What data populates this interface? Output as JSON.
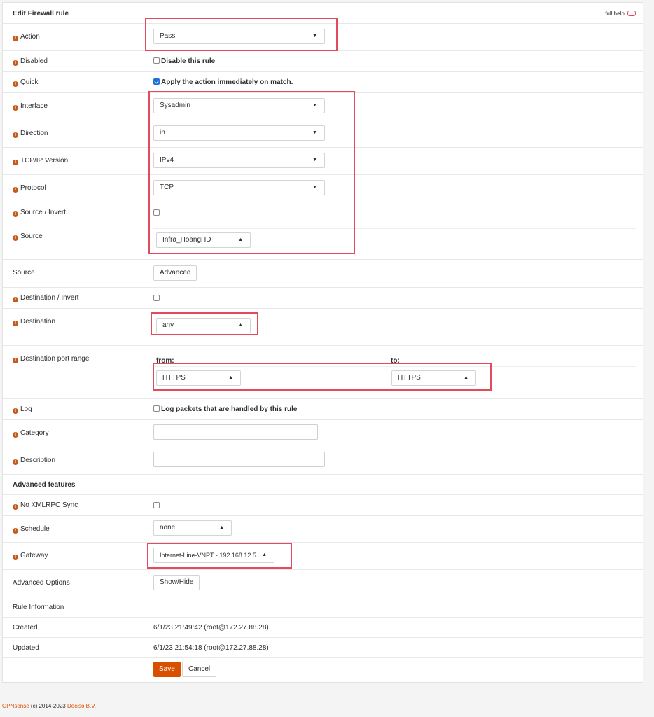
{
  "panel": {
    "title": "Edit Firewall rule",
    "full_help": "full help"
  },
  "rows": {
    "action": {
      "label": "Action",
      "value": "Pass"
    },
    "disabled": {
      "label": "Disabled",
      "checkbox_label": "Disable this rule"
    },
    "quick": {
      "label": "Quick",
      "checkbox_label": "Apply the action immediately on match."
    },
    "interface": {
      "label": "Interface",
      "value": "Sysadmin"
    },
    "direction": {
      "label": "Direction",
      "value": "in"
    },
    "ipversion": {
      "label": "TCP/IP Version",
      "value": "IPv4"
    },
    "protocol": {
      "label": "Protocol",
      "value": "TCP"
    },
    "source_invert": {
      "label": "Source / Invert"
    },
    "source": {
      "label": "Source",
      "value": "Infra_HoangHD"
    },
    "source_adv": {
      "label": "Source",
      "button": "Advanced"
    },
    "dest_invert": {
      "label": "Destination / Invert"
    },
    "destination": {
      "label": "Destination",
      "value": "any"
    },
    "dest_port": {
      "label": "Destination port range",
      "from_label": "from:",
      "to_label": "to:",
      "from_value": "HTTPS",
      "to_value": "HTTPS"
    },
    "log": {
      "label": "Log",
      "checkbox_label": "Log packets that are handled by this rule"
    },
    "category": {
      "label": "Category",
      "value": ""
    },
    "description": {
      "label": "Description",
      "value": ""
    },
    "advanced_features": {
      "label": "Advanced features"
    },
    "no_xmlrpc": {
      "label": "No XMLRPC Sync"
    },
    "schedule": {
      "label": "Schedule",
      "value": "none"
    },
    "gateway": {
      "label": "Gateway",
      "value": "Internet-Line-VNPT - 192.168.12.5"
    },
    "advanced_options": {
      "label": "Advanced Options",
      "button": "Show/Hide"
    },
    "rule_info": {
      "label": "Rule Information"
    },
    "created": {
      "label": "Created",
      "value": "6/1/23 21:49:42 (root@172.27.88.28)"
    },
    "updated": {
      "label": "Updated",
      "value": "6/1/23 21:54:18 (root@172.27.88.28)"
    }
  },
  "actions": {
    "save": "Save",
    "cancel": "Cancel"
  },
  "footer": {
    "brand": "OPNsense",
    "copyright": "(c) 2014-2023",
    "company": "Deciso B.V."
  },
  "colors": {
    "accent": "#d94f00",
    "highlight": "#e34b5c",
    "checkbox": "#1d6fd8"
  }
}
